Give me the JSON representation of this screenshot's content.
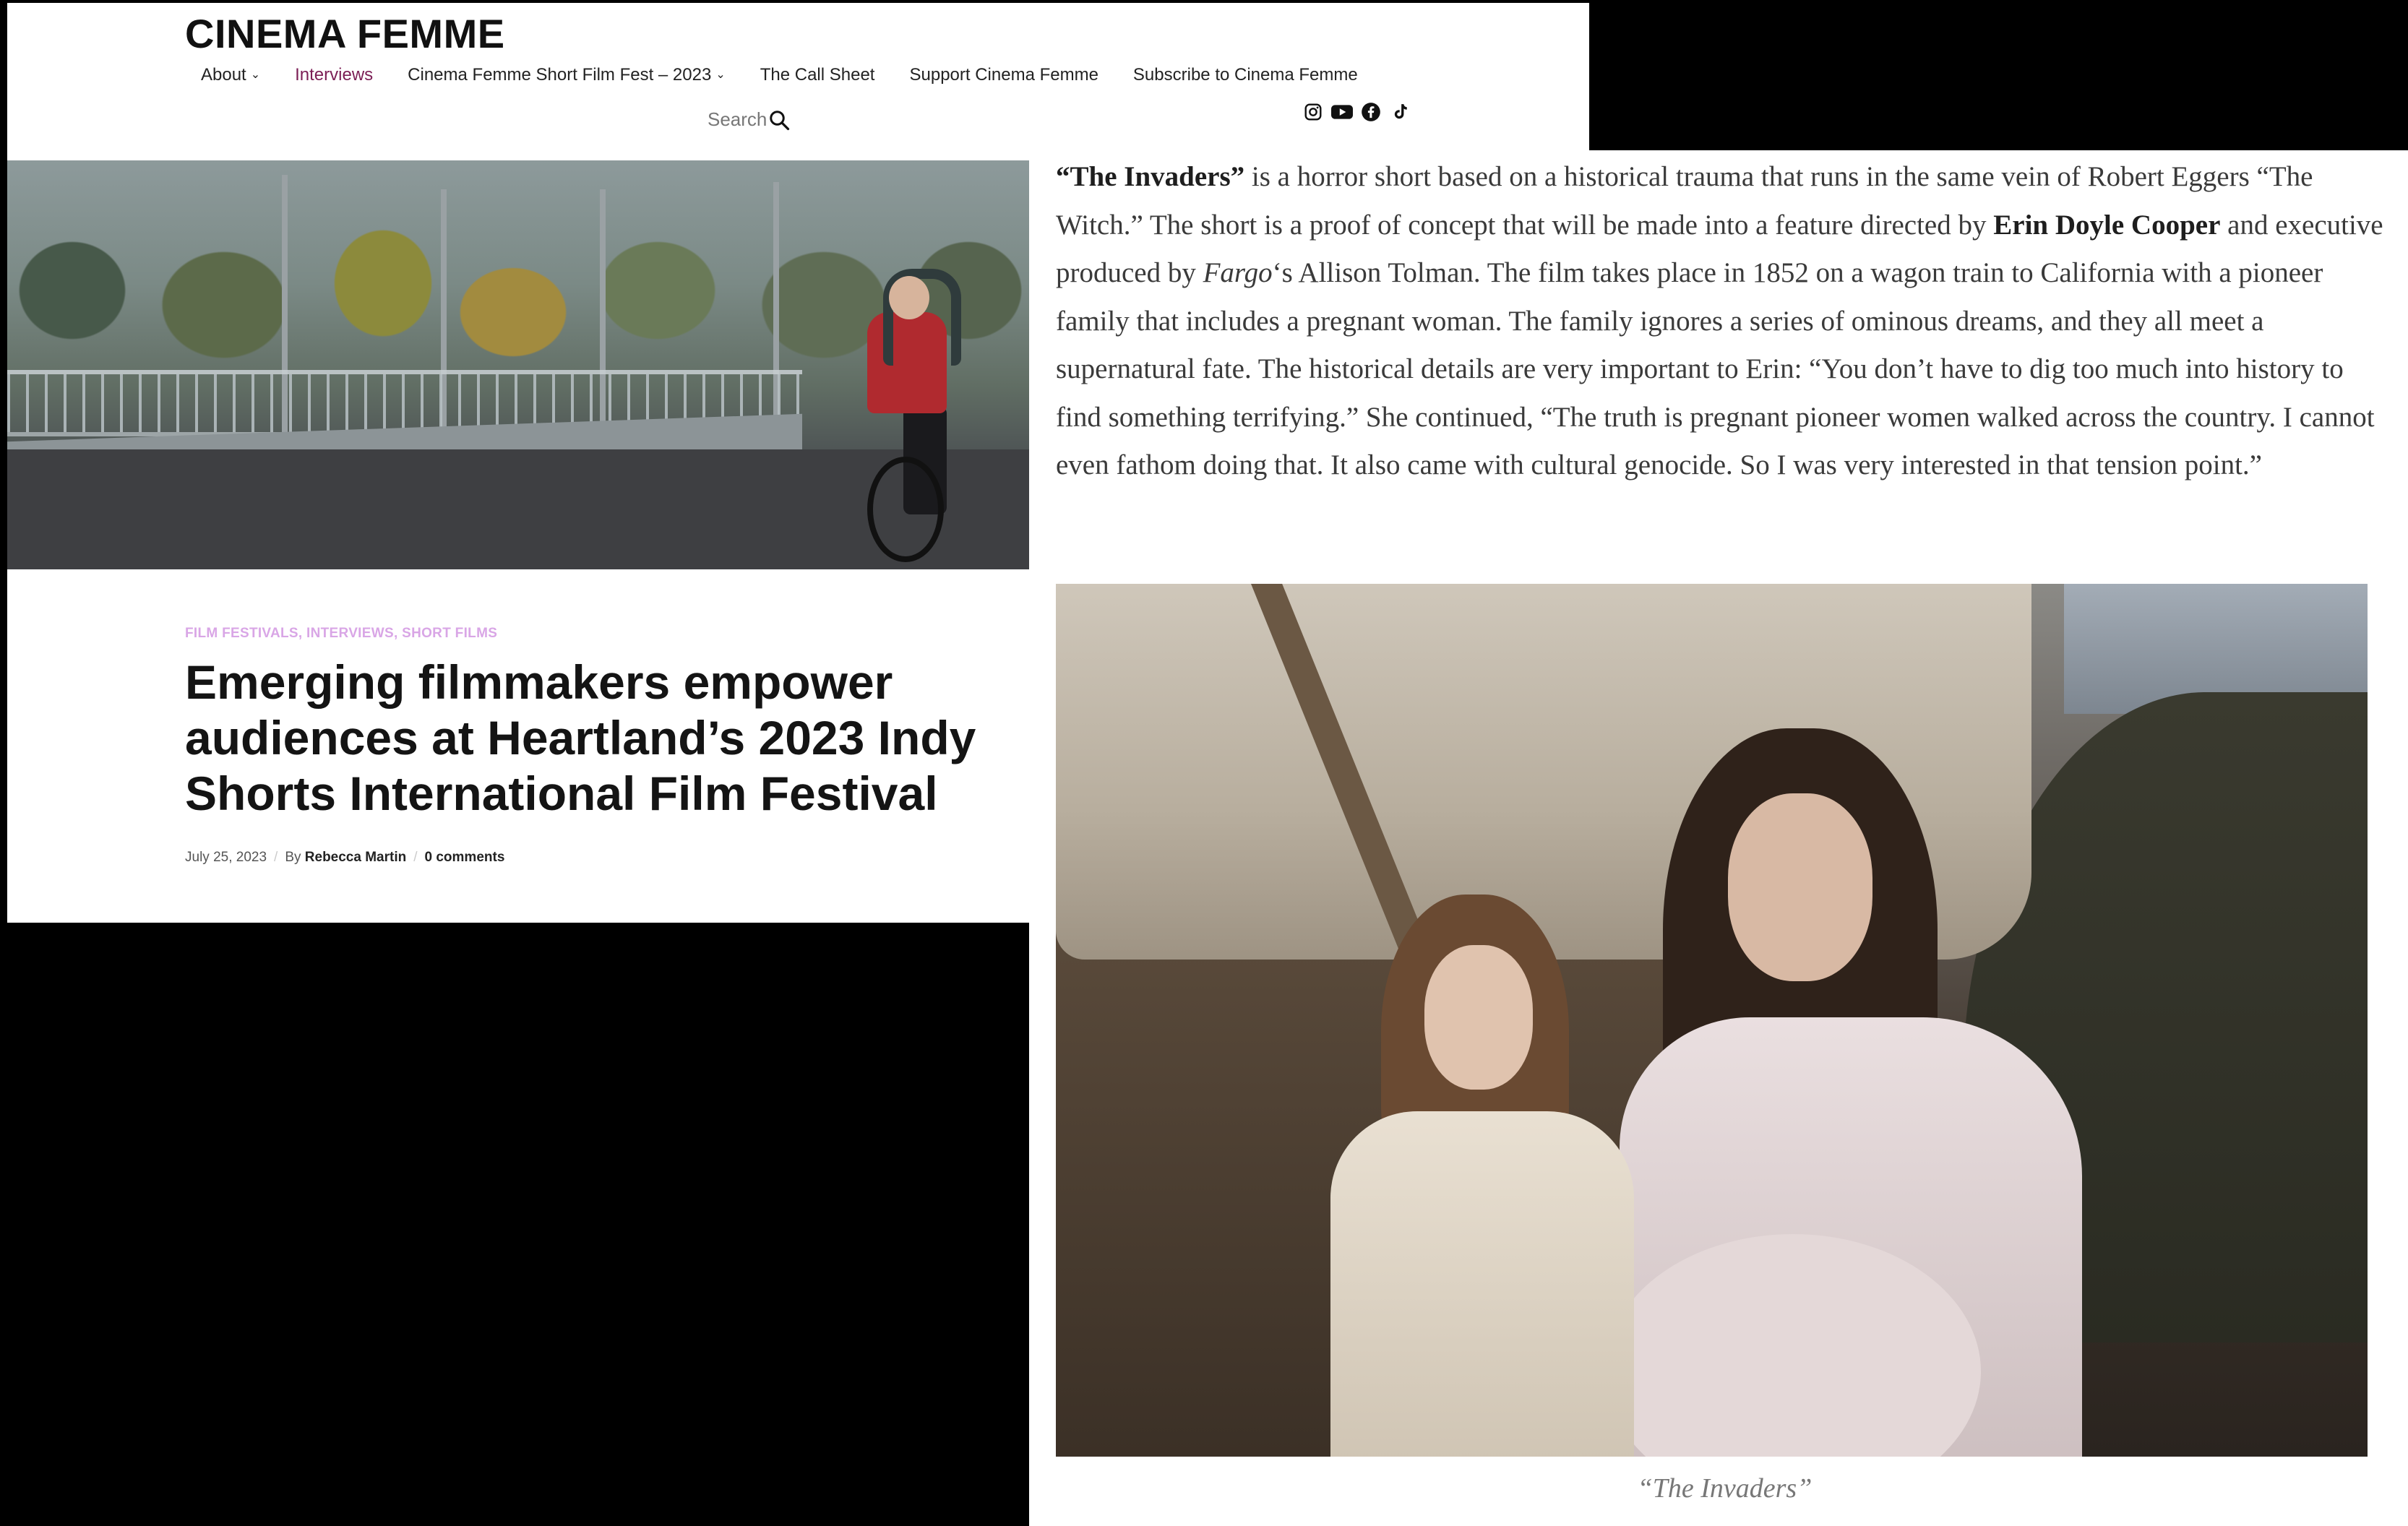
{
  "site": {
    "title": "CINEMA FEMME"
  },
  "nav": {
    "items": [
      {
        "label": "About",
        "has_dropdown": true,
        "active": false
      },
      {
        "label": "Interviews",
        "has_dropdown": false,
        "active": true
      },
      {
        "label": "Cinema Femme Short Film Fest – 2023",
        "has_dropdown": true,
        "active": false
      },
      {
        "label": "The Call Sheet",
        "has_dropdown": false,
        "active": false
      },
      {
        "label": "Support Cinema Femme",
        "has_dropdown": false,
        "active": false
      },
      {
        "label": "Subscribe to Cinema Femme",
        "has_dropdown": false,
        "active": false
      }
    ],
    "active_color": "#7b1e55"
  },
  "search": {
    "label": "Search",
    "icon": "search-icon"
  },
  "socials": [
    "instagram-icon",
    "youtube-icon",
    "facebook-icon",
    "tiktok-icon"
  ],
  "post": {
    "categories": "FILM FESTIVALS, INTERVIEWS, SHORT FILMS",
    "category_color": "#d9a6e6",
    "title": "Emerging filmmakers empower audiences at Heartland’s 2023 Indy Shorts International Film Festival",
    "date": "July 25, 2023",
    "by": "By",
    "author": "Rebecca Martin",
    "comments": "0 comments"
  },
  "article": {
    "p1": "“The Invaders”",
    "p2": " is a horror short based on a historical trauma that runs in the same vein of Robert Eggers “The Witch.” The short is a proof of concept that will be made into a feature directed by ",
    "p3": "Erin Doyle Cooper",
    "p4": " and executive produced by ",
    "p5": "Fargo",
    "p6": "‘s Allison Tolman. The film takes place in 1852 on a wagon train to California with a pioneer family that includes a pregnant woman. The family ignores a series of ominous dreams, and they all meet a supernatural fate. The historical details are very important to Erin: “You don’t have to dig too much into history to find something terrifying.” She continued, “The truth is pregnant pioneer women walked across the country. I cannot even fathom doing that. It also came with cultural genocide. So I was very interested in that tension point.”",
    "caption": "“The Invaders”"
  }
}
